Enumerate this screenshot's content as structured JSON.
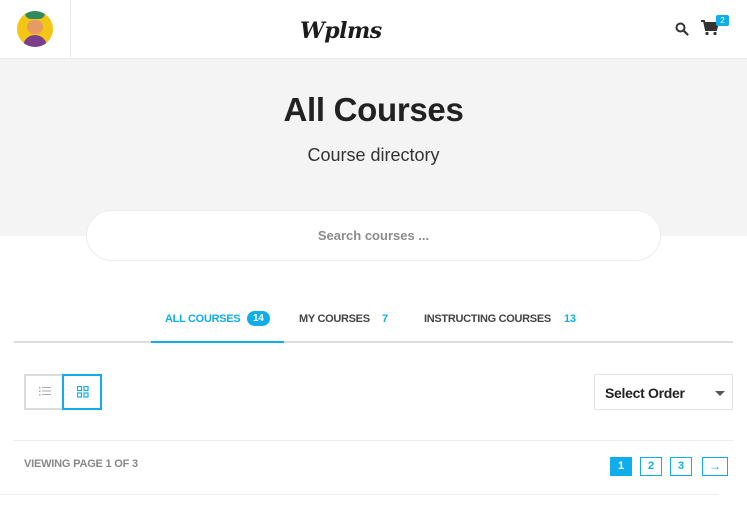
{
  "header": {
    "logo_text": "Wplms",
    "cart_count": "2"
  },
  "hero": {
    "title": "All Courses",
    "subtitle": "Course directory"
  },
  "search": {
    "placeholder": "Search courses ..."
  },
  "tabs": [
    {
      "label": "ALL COURSES",
      "count": "14",
      "active": true
    },
    {
      "label": "MY COURSES",
      "count": "7",
      "active": false
    },
    {
      "label": "INSTRUCTING COURSES",
      "count": "13",
      "active": false
    }
  ],
  "filters": {
    "view_mode": "grid",
    "select_order": "Select Order"
  },
  "pagination": {
    "viewing_text": "VIEWING PAGE 1 OF 3",
    "pages": [
      "1",
      "2",
      "3"
    ],
    "current_page": "1",
    "next_label": "→"
  },
  "colors": {
    "accent": "#0faeea",
    "hero_bg": "#f4f4f4"
  }
}
